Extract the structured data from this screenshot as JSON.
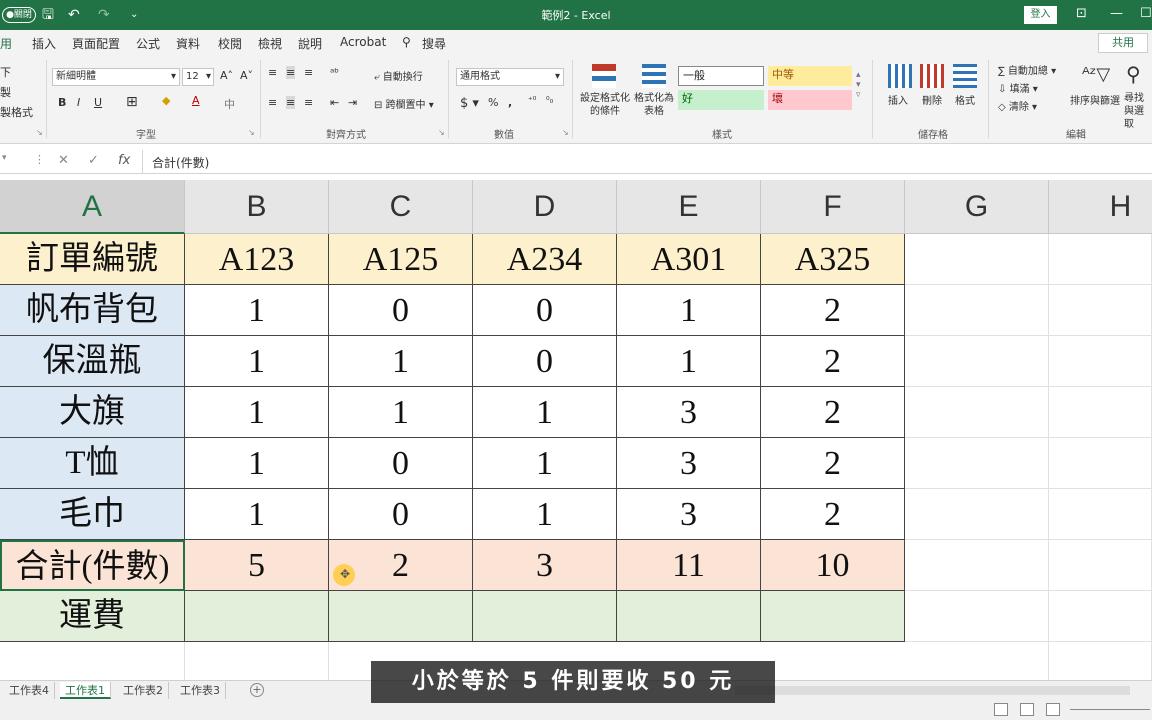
{
  "titlebar": {
    "autosave": "●關閉",
    "title": "範例2  -  Excel",
    "signin": "登入"
  },
  "tabs": [
    "用",
    "插入",
    "頁面配置",
    "公式",
    "資料",
    "校閱",
    "檢視",
    "說明",
    "Acrobat",
    "搜尋"
  ],
  "share": "共用",
  "ribbon": {
    "clipboard": [
      "下",
      "製",
      "製格式"
    ],
    "font_name": "新細明體",
    "font_size": "12",
    "font_group": "字型",
    "wrap_text": "自動換行",
    "merge_center": "跨欄置中",
    "align_group": "對齊方式",
    "number_format": "通用格式",
    "number_group": "數值",
    "cond_format": "設定格式化的條件",
    "format_table": "格式化為表格",
    "style_normal": "一般",
    "style_neutral": "中等",
    "style_good": "好",
    "style_bad": "壞",
    "styles_group": "樣式",
    "insert": "插入",
    "delete": "刪除",
    "format": "格式",
    "cells_group": "儲存格",
    "autosum": "自動加總",
    "fill": "填滿",
    "clear": "清除",
    "sort_filter": "排序與篩選",
    "find_select": "尋找與選取",
    "edit_group": "編輯"
  },
  "formula": "合計(件數)",
  "columns": [
    "A",
    "B",
    "C",
    "D",
    "E",
    "F",
    "G",
    "H"
  ],
  "table": {
    "header_label": "訂單編號",
    "orders": [
      "A123",
      "A125",
      "A234",
      "A301",
      "A325"
    ],
    "rows": [
      {
        "label": "帆布背包",
        "values": [
          "1",
          "0",
          "0",
          "1",
          "2"
        ]
      },
      {
        "label": "保溫瓶",
        "values": [
          "1",
          "1",
          "0",
          "1",
          "2"
        ]
      },
      {
        "label": "大旗",
        "values": [
          "1",
          "1",
          "1",
          "3",
          "2"
        ]
      },
      {
        "label": "T恤",
        "values": [
          "1",
          "0",
          "1",
          "3",
          "2"
        ]
      },
      {
        "label": "毛巾",
        "values": [
          "1",
          "0",
          "1",
          "3",
          "2"
        ]
      }
    ],
    "total": {
      "label": "合計(件數)",
      "values": [
        "5",
        "2",
        "3",
        "11",
        "10"
      ]
    },
    "fee": {
      "label": "運費"
    }
  },
  "sheets": [
    "工作表4",
    "工作表1",
    "工作表2",
    "工作表3"
  ],
  "active_sheet": "工作表1",
  "subtitle": "小於等於 5 件則要收 50 元"
}
